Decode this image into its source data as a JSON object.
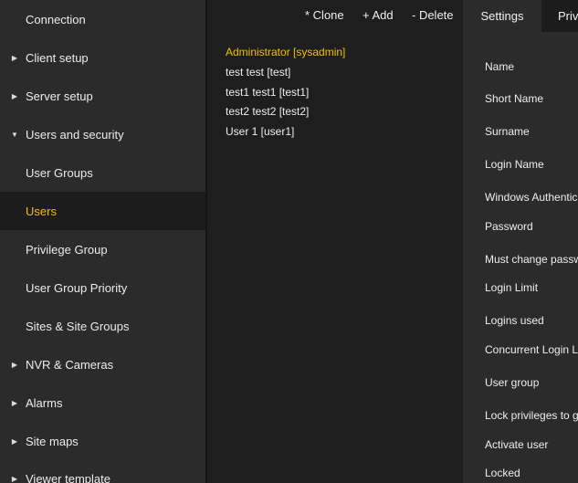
{
  "sidebar": {
    "items": [
      {
        "label": "Connection",
        "arrow": ""
      },
      {
        "label": "Client setup",
        "arrow": "▶"
      },
      {
        "label": "Server setup",
        "arrow": "▶"
      },
      {
        "label": "Users and security",
        "arrow": "▼"
      },
      {
        "label": "User Groups",
        "arrow": ""
      },
      {
        "label": "Users",
        "arrow": ""
      },
      {
        "label": "Privilege Group",
        "arrow": ""
      },
      {
        "label": "User Group Priority",
        "arrow": ""
      },
      {
        "label": "Sites & Site Groups",
        "arrow": ""
      },
      {
        "label": "NVR & Cameras",
        "arrow": "▶"
      },
      {
        "label": "Alarms",
        "arrow": "▶"
      },
      {
        "label": "Site maps",
        "arrow": "▶"
      },
      {
        "label": "Viewer template",
        "arrow": "▶"
      }
    ],
    "active_index": 5
  },
  "toolbar": {
    "clone_label": "* Clone",
    "add_label": "+ Add",
    "delete_label": "- Delete"
  },
  "users": {
    "items": [
      "Administrator [sysadmin]",
      "test test [test]",
      "test1 test1 [test1]",
      "test2 test2 [test2]",
      "User 1 [user1]"
    ],
    "selected_index": 0
  },
  "tabs": {
    "settings_label": "Settings",
    "privileges_label": "Privi"
  },
  "form": {
    "labels": [
      "Name",
      "Short Name",
      "Surname",
      "Login Name",
      "Windows Authentication",
      "Password",
      "Must change password",
      "Login Limit",
      "Logins used",
      "Concurrent Login Limit",
      "User group",
      "Lock privileges to group",
      "Activate user",
      "Locked"
    ]
  },
  "colors": {
    "accent": "#f2c200",
    "sidebar_bg": "#2b2b2b",
    "main_bg": "#1e1e1e"
  }
}
